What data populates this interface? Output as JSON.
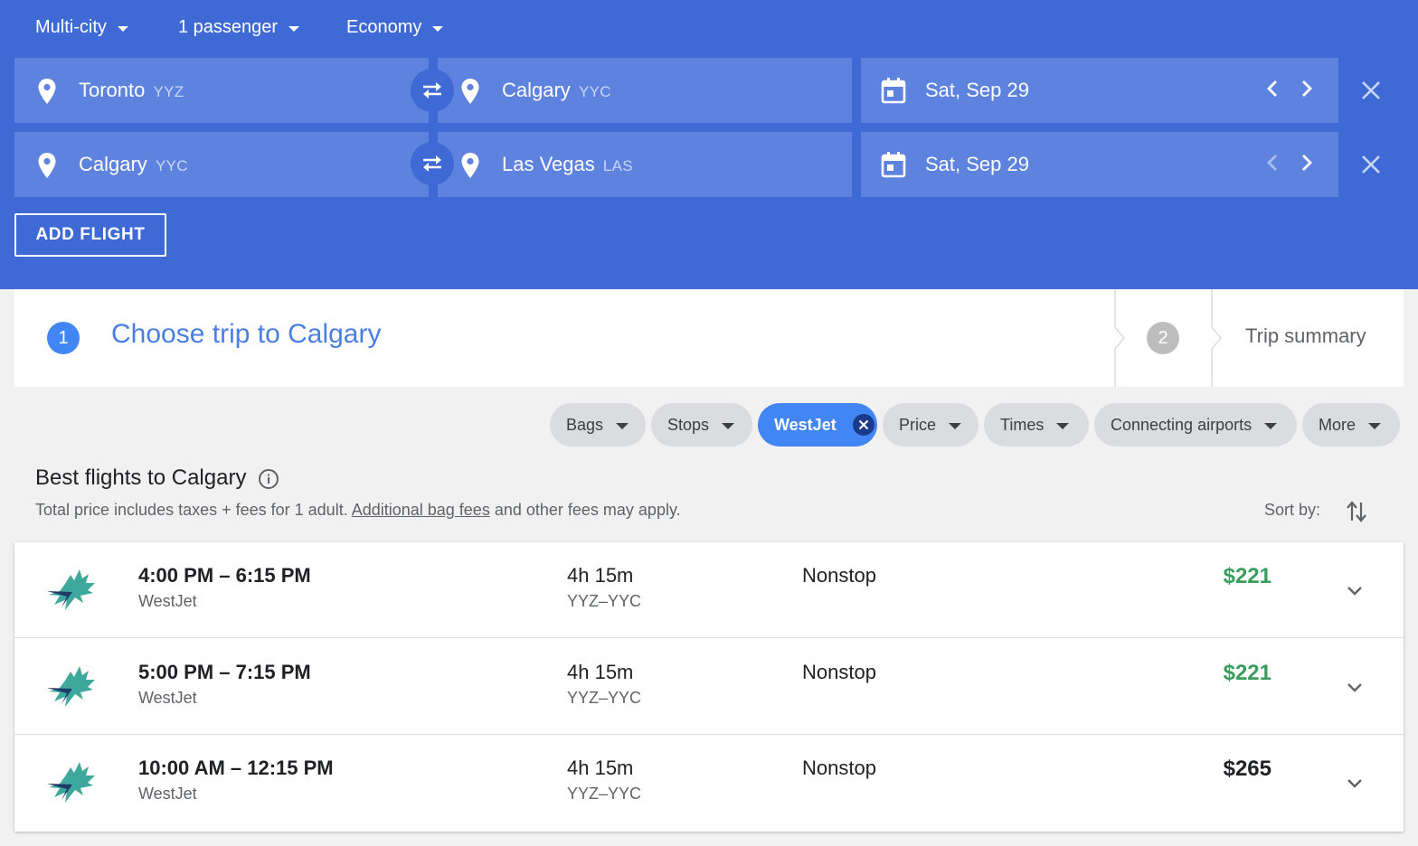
{
  "search": {
    "trip_type": "Multi-city",
    "passengers": "1 passenger",
    "cabin": "Economy",
    "legs": [
      {
        "origin_city": "Toronto",
        "origin_code": "YYZ",
        "dest_city": "Calgary",
        "dest_code": "YYC",
        "date": "Sat, Sep 29"
      },
      {
        "origin_city": "Calgary",
        "origin_code": "YYC",
        "dest_city": "Las Vegas",
        "dest_code": "LAS",
        "date": "Sat, Sep 29"
      }
    ],
    "add_flight_label": "ADD FLIGHT"
  },
  "steps": {
    "step1_number": "1",
    "step1_title": "Choose trip to Calgary",
    "step2_number": "2",
    "step2_title": "Trip summary"
  },
  "filters": {
    "bags": "Bags",
    "stops": "Stops",
    "airline": "WestJet",
    "price": "Price",
    "times": "Times",
    "connecting": "Connecting airports",
    "more": "More"
  },
  "results": {
    "title": "Best flights to Calgary",
    "subtitle_pre": "Total price includes taxes + fees for 1 adult. ",
    "subtitle_link": "Additional bag fees",
    "subtitle_post": " and other fees may apply.",
    "sort_label": "Sort by:"
  },
  "flights": [
    {
      "times": "4:00 PM – 6:15 PM",
      "airline": "WestJet",
      "duration": "4h 15m",
      "route": "YYZ–YYC",
      "stops": "Nonstop",
      "price": "$221",
      "price_color": "#3a9d5d"
    },
    {
      "times": "5:00 PM – 7:15 PM",
      "airline": "WestJet",
      "duration": "4h 15m",
      "route": "YYZ–YYC",
      "stops": "Nonstop",
      "price": "$221",
      "price_color": "#3a9d5d"
    },
    {
      "times": "10:00 AM – 12:15 PM",
      "airline": "WestJet",
      "duration": "4h 15m",
      "route": "YYZ–YYC",
      "stops": "Nonstop",
      "price": "$265",
      "price_color": "#202124"
    }
  ],
  "colors": {
    "header_bg": "#3f6ad5",
    "field_bg": "#5d83de",
    "accent": "#4285f4",
    "cheap_price": "#3a9d5d"
  }
}
